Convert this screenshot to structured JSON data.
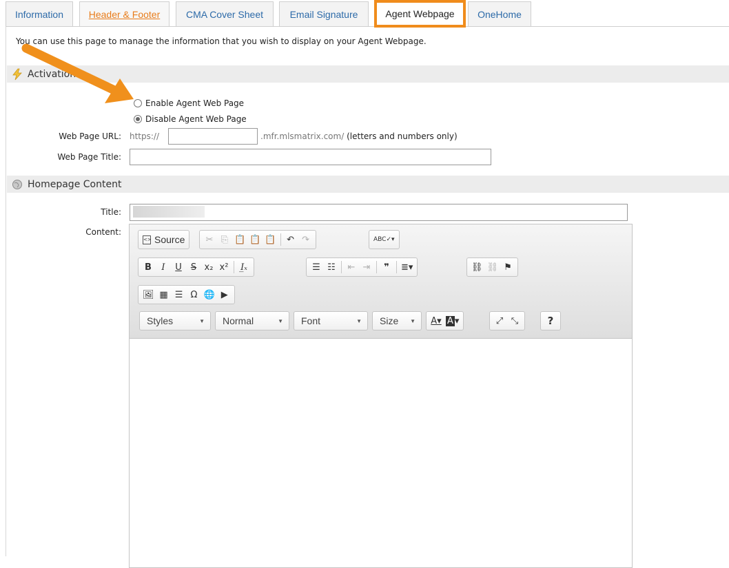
{
  "tabs": [
    {
      "label": "Information"
    },
    {
      "label": "Header & Footer"
    },
    {
      "label": "CMA Cover Sheet"
    },
    {
      "label": "Email Signature"
    },
    {
      "label": "Agent Webpage"
    },
    {
      "label": "OneHome"
    }
  ],
  "intro_text": "You can use this page to manage the information that you wish to display on your Agent Webpage.",
  "activation": {
    "title": "Activation",
    "enable_label": "Enable Agent Web Page",
    "disable_label": "Disable Agent Web Page",
    "selected": "disable",
    "url_label": "Web Page URL:",
    "url_prefix": "https://",
    "url_value": "",
    "url_suffix": ".mfr.mlsmatrix.com/",
    "url_hint": "(letters and numbers only)",
    "title_label": "Web Page Title:",
    "title_value": ""
  },
  "homepage": {
    "title": "Homepage Content",
    "title_label": "Title:",
    "content_label": "Content:"
  },
  "editor": {
    "source_label": "Source",
    "styles_label": "Styles",
    "format_label": "Normal",
    "font_label": "Font",
    "size_label": "Size",
    "help_label": "?"
  },
  "colors": {
    "tab_link": "#2c6aa8",
    "tab_highlight": "#f08c1c",
    "header_footer_link": "#e87c1a",
    "section_bg": "#ececec",
    "arrow": "#f0901c"
  }
}
